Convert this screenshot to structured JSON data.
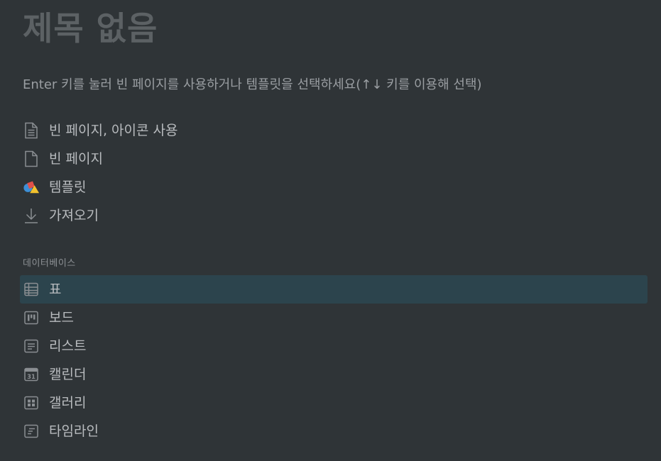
{
  "title": "제목 없음",
  "hint": "Enter 키를 눌러 빈 페이지를 사용하거나 템플릿을 선택하세요(↑↓ 키를 이용해 선택)",
  "options": [
    {
      "label": "빈 페이지, 아이콘 사용",
      "icon": "document-lines-icon"
    },
    {
      "label": "빈 페이지",
      "icon": "document-icon"
    },
    {
      "label": "템플릿",
      "icon": "template-shapes-icon"
    },
    {
      "label": "가져오기",
      "icon": "download-arrow-icon"
    }
  ],
  "database_section": {
    "label": "데이터베이스",
    "items": [
      {
        "label": "표",
        "icon": "table-icon",
        "selected": true
      },
      {
        "label": "보드",
        "icon": "board-icon"
      },
      {
        "label": "리스트",
        "icon": "list-icon"
      },
      {
        "label": "캘린더",
        "icon": "calendar-icon",
        "icon_text": "31"
      },
      {
        "label": "갤러리",
        "icon": "gallery-icon"
      },
      {
        "label": "타임라인",
        "icon": "timeline-icon"
      }
    ]
  },
  "colors": {
    "background": "#2f3437",
    "selected_row": "#2c444d",
    "icon_stroke": "#8a8e92",
    "template_red": "#e0504a",
    "template_blue": "#3d8fd6",
    "template_yellow": "#f2c12e"
  }
}
